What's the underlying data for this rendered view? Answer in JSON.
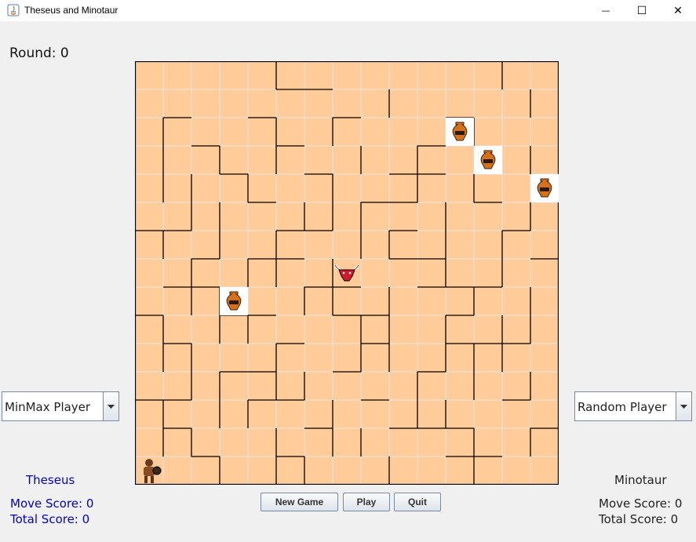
{
  "window": {
    "title": "Theseus and Minotaur",
    "minimize_glyph": "—",
    "maximize_glyph": "☐",
    "close_glyph": "✕"
  },
  "game": {
    "round_label": "Round: 0",
    "grid_cols": 15,
    "grid_rows": 15,
    "theseus": {
      "row": 14,
      "col": 0
    },
    "minotaur": {
      "row": 7,
      "col": 7
    },
    "supplies": [
      {
        "row": 2,
        "col": 11
      },
      {
        "row": 3,
        "col": 12
      },
      {
        "row": 4,
        "col": 14
      },
      {
        "row": 8,
        "col": 3
      }
    ]
  },
  "left_player": {
    "name": "Theseus",
    "selector_value": "MinMax Player",
    "move_score": "Move Score: 0",
    "total_score": "Total Score: 0",
    "color": "#0000cc"
  },
  "right_player": {
    "name": "Minotaur",
    "selector_value": "Random Player",
    "move_score": "Move Score: 0",
    "total_score": "Total Score: 0",
    "color": "#222222"
  },
  "controls": {
    "new_game": "New Game",
    "play": "Play",
    "quit": "Quit"
  },
  "colors": {
    "tile": "#ffcc99",
    "grid_line": "#e6e6e6",
    "wall": "#000000"
  }
}
